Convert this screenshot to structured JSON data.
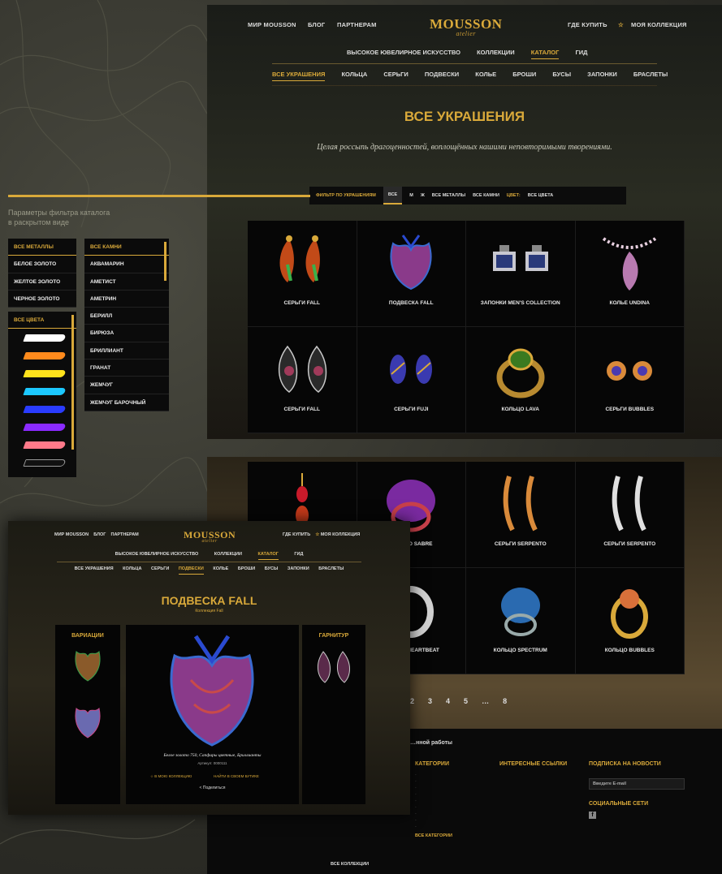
{
  "brand": {
    "logo": "MOUSSON",
    "logo_sub": "atelier"
  },
  "main_nav": {
    "mir": "МИР MOUSSON",
    "blog": "БЛОГ",
    "partners": "ПАРТНЕРАМ",
    "where_buy": "ГДЕ КУПИТЬ",
    "my_collection": "МОЯ КОЛЛЕКЦИЯ"
  },
  "sub_nav": [
    "ВЫСОКОЕ ЮВЕЛИРНОЕ ИСКУССТВО",
    "КОЛЛЕКЦИИ",
    "КАТАЛОГ",
    "ГИД"
  ],
  "cat_nav": [
    "ВСЕ УКРАШЕНИЯ",
    "КОЛЬЦА",
    "СЕРЬГИ",
    "ПОДВЕСКИ",
    "КОЛЬЕ",
    "БРОШИ",
    "БУСЫ",
    "ЗАПОНКИ",
    "БРАСЛЕТЫ"
  ],
  "page": {
    "title": "ВСЕ УКРАШЕНИЯ",
    "tagline": "Целая россыпь драгоценностей, воплощённых нашими неповторимыми творениями."
  },
  "filter": {
    "label": "ФИЛЬТР ПО УКРАШЕНИЯМ",
    "all": "ВСЕ",
    "m": "М",
    "f": "Ж",
    "metals": "ВСЕ МЕТАЛЛЫ",
    "stones": "ВСЕ КАМНИ",
    "color_label": "ЦВЕТ:",
    "colors": "ВСЕ ЦВЕТА"
  },
  "note": [
    "Параметры фильтра каталога",
    "в раскрытом виде"
  ],
  "metals": [
    "ВСЕ МЕТАЛЛЫ",
    "БЕЛОЕ ЗОЛОТО",
    "ЖЕЛТОЕ ЗОЛОТО",
    "ЧЕРНОЕ ЗОЛОТО"
  ],
  "stones": [
    "ВСЕ КАМНИ",
    "АКВАМАРИН",
    "АМЕТИСТ",
    "АМЕТРИН",
    "БЕРИЛЛ",
    "БИРЮЗА",
    "БРИЛЛИАНТ",
    "ГРАНАТ",
    "ЖЕМЧУГ",
    "ЖЕМЧУГ БАРОЧНЫЙ"
  ],
  "colors_box": {
    "title": "ВСЕ ЦВЕТА",
    "swatches": [
      "#ffffff",
      "#ff8a1c",
      "#ffe21c",
      "#1cc8ff",
      "#2a3cff",
      "#8a2aff",
      "#ff7a8a",
      "#111111"
    ]
  },
  "products": [
    "СЕРЬГИ FALL",
    "ПОДВЕСКА FALL",
    "ЗАПОНКИ MEN'S COLLECTION",
    "КОЛЬЕ UNDINA",
    "СЕРЬГИ FALL",
    "СЕРЬГИ FUJI",
    "КОЛЬЦО LAVA",
    "СЕРЬГИ BUBBLES"
  ],
  "products2": [
    "",
    "КОЛЬЦО SABRE",
    "СЕРЬГИ SERPENTO",
    "СЕРЬГИ SERPENTO",
    "",
    "КОЛЬЦО HEARTBEAT",
    "КОЛЬЦО SPECTRUM",
    "КОЛЬЦО BUBBLES"
  ],
  "pager": [
    "2",
    "3",
    "4",
    "5",
    "…",
    "8"
  ],
  "footer": {
    "about": "…нной работы",
    "cats": "КАТЕГОРИИ",
    "links": "ИНТЕРЕСНЫЕ ССЫЛКИ",
    "subscribe": "ПОДПИСКА НА НОВОСТИ",
    "email_ph": "Введите E-mail",
    "social": "СОЦИАЛЬНЫЕ СЕТИ",
    "all_coll": "ВСЕ КОЛЛЕКЦИИ",
    "all_cats": "ВСЕ КАТЕГОРИИ"
  },
  "detail": {
    "title": "ПОДВЕСКА FALL",
    "collection": "Коллекция Fall",
    "variations": "ВАРИАЦИИ",
    "set": "ГАРНИТУР",
    "desc": "Белое золото 750, Сапфиры цветные, Бриллианты",
    "article": "Артикул: 0000111",
    "add": "В МОЮ КОЛЛЕКЦИЮ",
    "where": "НАЙТИ В СВОЕМ БУТИКЕ",
    "share": "Поделиться"
  }
}
